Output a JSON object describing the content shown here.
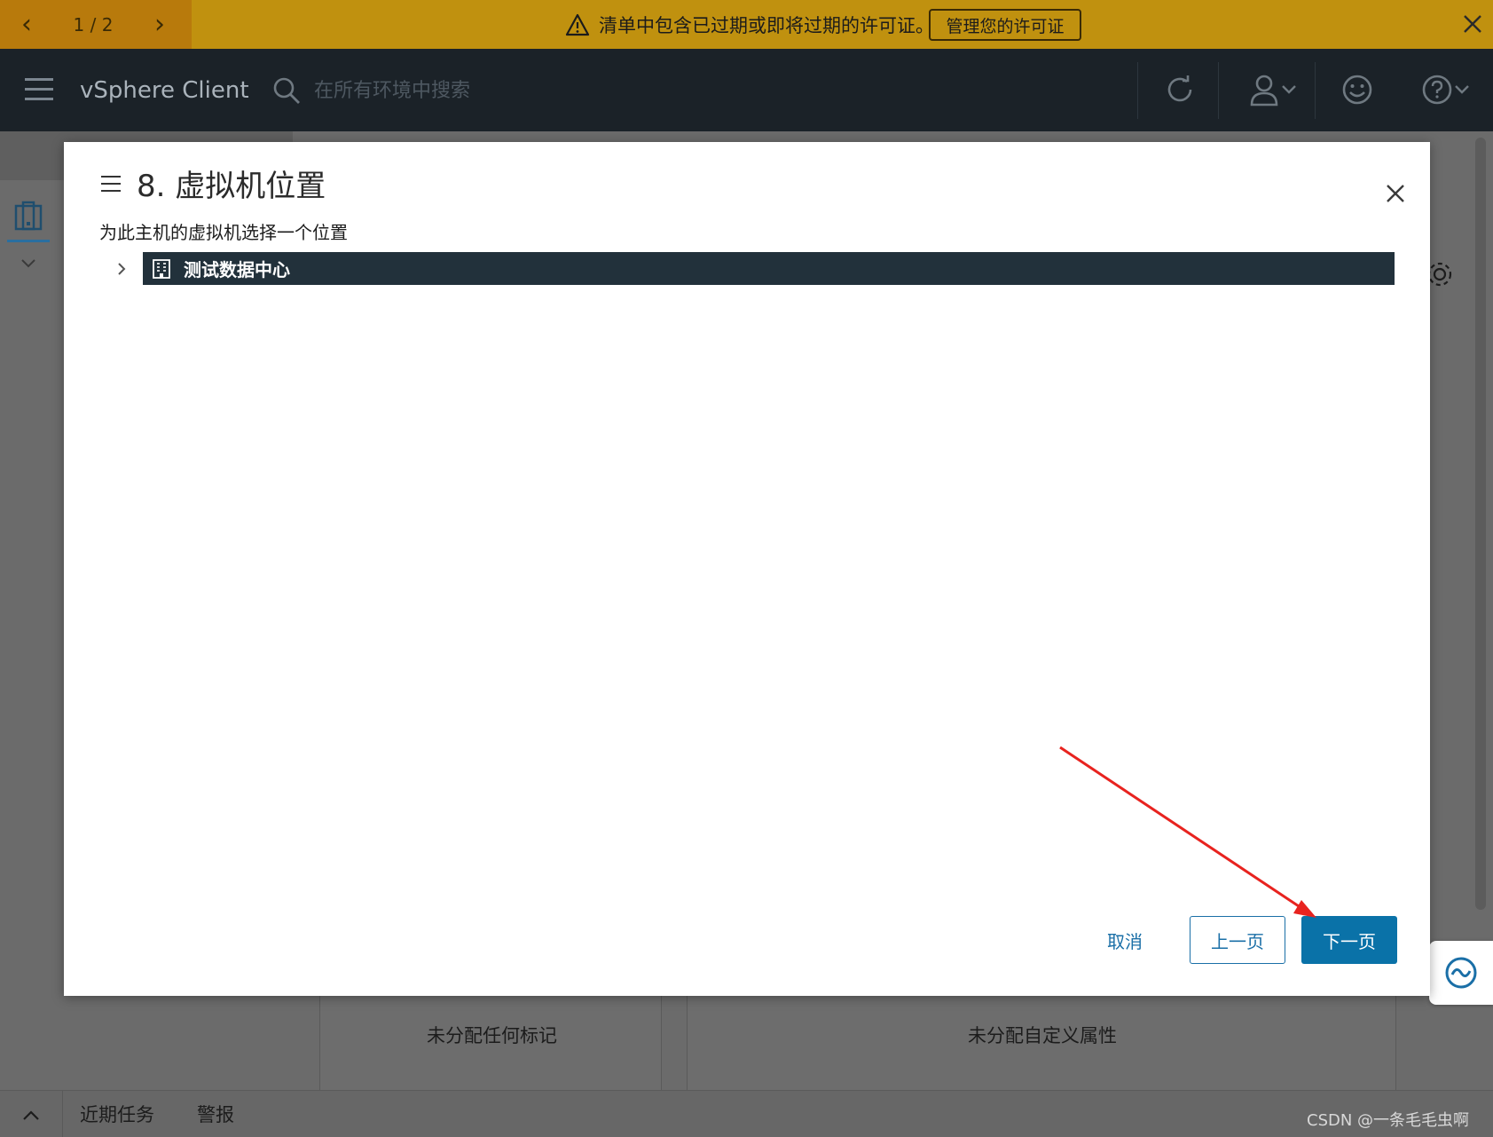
{
  "banner": {
    "pager": "1 / 2",
    "message": "清单中包含已过期或即将过期的许可证。",
    "button_label": "管理您的许可证"
  },
  "header": {
    "app_title": "vSphere Client",
    "search_placeholder": "在所有环境中搜索"
  },
  "modal": {
    "title": "8. 虚拟机位置",
    "description": "为此主机的虚拟机选择一个位置",
    "tree": [
      {
        "label": "测试数据中心",
        "icon": "datacenter-icon",
        "selected": true,
        "expanded": false
      }
    ],
    "buttons": {
      "cancel": "取消",
      "prev": "上一页",
      "next": "下一页"
    }
  },
  "background": {
    "panel_tags_text": "未分配任何标记",
    "panel_attrs_text": "未分配自定义属性",
    "bottom_tabs": [
      "近期任务",
      "警报"
    ]
  },
  "watermark": "CSDN @一条毛毛虫啊",
  "colors": {
    "banner": "#c0910f",
    "header": "#1b2228",
    "primary": "#0a72a8",
    "tree_selected": "#22313b",
    "annotation_arrow": "#e8231f"
  }
}
